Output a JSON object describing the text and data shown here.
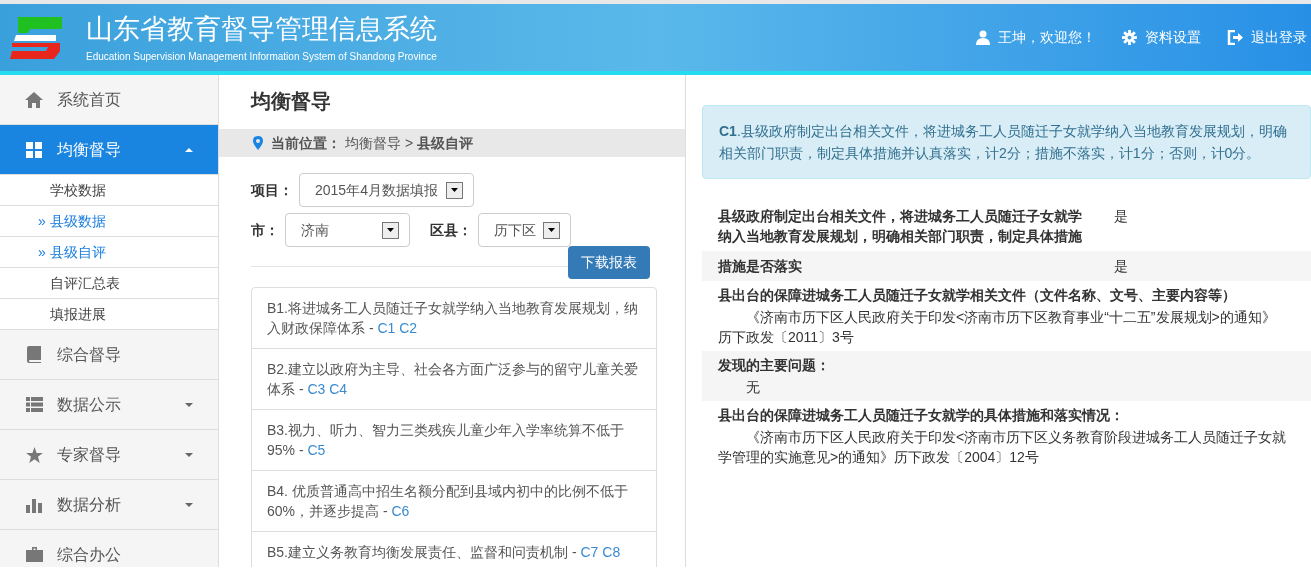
{
  "header": {
    "title": "山东省教育督导管理信息系统",
    "subtitle": "Education Supervision Management Information System of Shandong Province",
    "actions": [
      {
        "kind": "user",
        "label": "王坤，欢迎您！"
      },
      {
        "kind": "settings",
        "label": "资料设置"
      },
      {
        "kind": "logout",
        "label": "退出登录"
      }
    ]
  },
  "sidebar": {
    "items": [
      {
        "label": "系统首页",
        "selected": false
      },
      {
        "label": "均衡督导",
        "selected": true,
        "expanded": true,
        "children": [
          {
            "label": "学校数据",
            "selected": false
          },
          {
            "label": "县级数据",
            "selected": true,
            "prefix": "»"
          },
          {
            "label": "县级自评",
            "selected": true,
            "prefix": "»"
          },
          {
            "label": "自评汇总表",
            "selected": false
          },
          {
            "label": "填报进展",
            "selected": false
          }
        ]
      },
      {
        "label": "综合督导",
        "selected": false
      },
      {
        "label": "数据公示",
        "selected": false,
        "expanded": false
      },
      {
        "label": "专家督导",
        "selected": false,
        "expanded": false
      },
      {
        "label": "数据分析",
        "selected": false,
        "expanded": false
      },
      {
        "label": "综合办公",
        "selected": false
      }
    ]
  },
  "page": {
    "title": "均衡督导",
    "breadcrumb": {
      "label": "当前位置：",
      "path": "均衡督导",
      "separator": ">",
      "current": "县级自评"
    },
    "filters": [
      {
        "label": "项目：",
        "value": "2015年4月数据填报"
      },
      {
        "label": "市：",
        "value": "济南"
      },
      {
        "label": "区县：",
        "value": "历下区"
      }
    ],
    "download_button": "下载报表",
    "standards": [
      {
        "text": "B1.将进城务工人员随迁子女就学纳入当地教育发展规划，纳入财政保障体系",
        "separator": "-",
        "links": [
          "C1",
          "C2"
        ]
      },
      {
        "text": "B2.建立以政府为主导、社会各方面广泛参与的留守儿童关爱体系",
        "separator": "-",
        "links": [
          "C3",
          "C4"
        ]
      },
      {
        "text": "B3.视力、听力、智力三类残疾儿童少年入学率统算不低于95%",
        "separator": "-",
        "links": [
          "C5"
        ]
      },
      {
        "text": "B4. 优质普通高中招生名额分配到县域内初中的比例不低于60%，并逐步提高",
        "separator": "-",
        "links": [
          "C6"
        ]
      },
      {
        "text": "B5.建立义务教育均衡发展责任、监督和问责机制",
        "separator": "-",
        "links": [
          "C7",
          "C8"
        ]
      }
    ]
  },
  "detail": {
    "criterion": "**C1**.县级政府制定出台相关文件，将进城务工人员随迁子女就学纳入当地教育发展规划，明确相关部门职责，制定具体措施并认真落实，计2分；措施不落实，计1分；否则，计0分。",
    "rows": [
      {
        "kind": "pair",
        "question": "县级政府制定出台相关文件，将进城务工人员随迁子女就学纳入当地教育发展规划，明确相关部门职责，制定具体措施",
        "answer": "是"
      },
      {
        "kind": "pair",
        "question": "措施是否落实",
        "answer": "是"
      },
      {
        "kind": "section",
        "question": "县出台的保障进城务工人员随迁子女就学相关文件（文件名称、文号、主要内容等）",
        "answer": "《济南市历下区人民政府关于印发<济南市历下区教育事业“十二五”发展规划>的通知》历下政发〔2011〕3号"
      },
      {
        "kind": "section",
        "question": "发现的主要问题：",
        "answer": "无"
      },
      {
        "kind": "section",
        "question": "县出台的保障进城务工人员随迁子女就学的具体措施和落实情况：",
        "answer": "《济南市历下区人民政府关于印发<济南市历下区义务教育阶段进城务工人员随迁子女就学管理的实施意见>的通知》历下政发〔2004〕12号"
      }
    ]
  }
}
